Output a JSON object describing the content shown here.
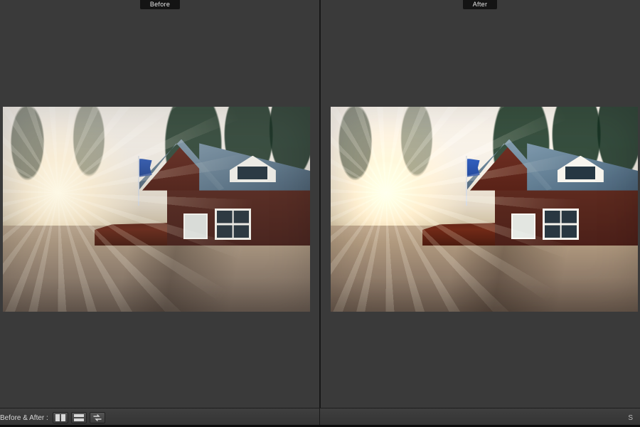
{
  "header": {
    "before_label": "Before",
    "after_label": "After"
  },
  "toolbar": {
    "before_after_label": "Before & After :",
    "buttons": {
      "side_by_side": "before-after-side-by-side",
      "top_bottom": "before-after-top-bottom",
      "swap": "before-after-swap"
    },
    "soft_proofing_initial": "S"
  },
  "colors": {
    "panel_bg": "#3a3a3a",
    "divider": "#171717",
    "label_bg": "#141414",
    "label_fg": "#e6e6e6",
    "toolbar_top": "#3f3f3f",
    "toolbar_bottom": "#333333"
  }
}
